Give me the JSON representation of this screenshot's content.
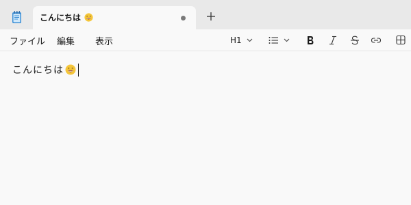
{
  "app": {
    "icon": "notepad-icon"
  },
  "tab": {
    "title": "こんにちは",
    "emoji": "grinning-face-icon",
    "modified_indicator": "unsaved-dot-icon"
  },
  "menu": {
    "items": [
      "ファイル",
      "編集",
      "表示"
    ]
  },
  "toolbar": {
    "heading_label": "H1",
    "tools": [
      "heading-dropdown",
      "list-icon",
      "bold-icon",
      "italic-icon",
      "strikethrough-icon",
      "link-icon",
      "table-icon"
    ]
  },
  "editor": {
    "text": "こんにちは",
    "emoji": "grinning-face-icon"
  },
  "colors": {
    "tabstrip": "#e9e9e9",
    "surface": "#f9f9f9",
    "emoji_yellow": "#f5c63a"
  }
}
